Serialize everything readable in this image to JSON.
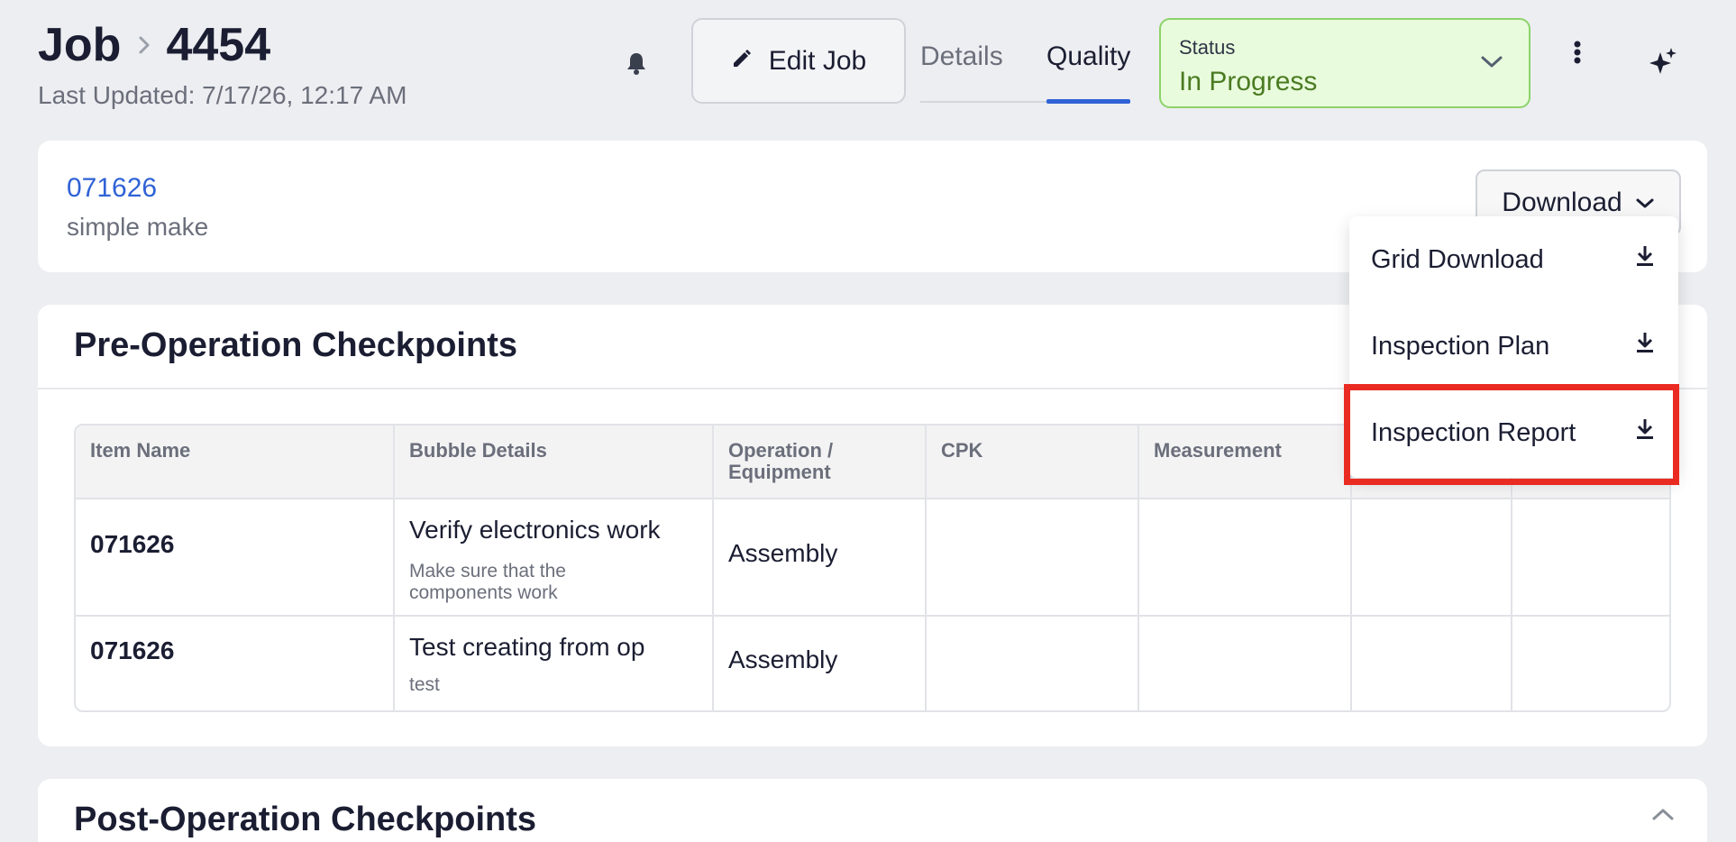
{
  "header": {
    "crumb_root": "Job",
    "crumb_id": "4454",
    "last_updated": "Last Updated: 7/17/26, 12:17 AM",
    "edit_label": "Edit Job",
    "tabs": [
      {
        "label": "Details",
        "active": false
      },
      {
        "label": "Quality",
        "active": true
      }
    ],
    "status": {
      "label": "Status",
      "value": "In Progress"
    }
  },
  "job_card": {
    "job_number": "071626",
    "job_subtitle": "simple make",
    "download_label": "Download"
  },
  "download_menu": {
    "items": [
      {
        "label": "Grid Download"
      },
      {
        "label": "Inspection Plan"
      },
      {
        "label": "Inspection Report"
      }
    ]
  },
  "pre_operation": {
    "title": "Pre-Operation Checkpoints",
    "columns": [
      "Item Name",
      "Bubble Details",
      "Operation / Equipment",
      "CPK",
      "Measurement"
    ],
    "rows": [
      {
        "item_name": "071626",
        "bubble_title": "Verify electronics work",
        "bubble_desc": "Make sure that the components work",
        "operation": "Assembly"
      },
      {
        "item_name": "071626",
        "bubble_title": "Test creating from op",
        "bubble_desc": "test",
        "operation": "Assembly"
      }
    ]
  },
  "post_operation": {
    "title": "Post-Operation Checkpoints"
  },
  "colors": {
    "accent": "#2f62d6",
    "status_bg": "#e9fbdd",
    "status_border": "#8cd36a",
    "status_text": "#4b7b22",
    "highlight": "#ea2b22"
  }
}
